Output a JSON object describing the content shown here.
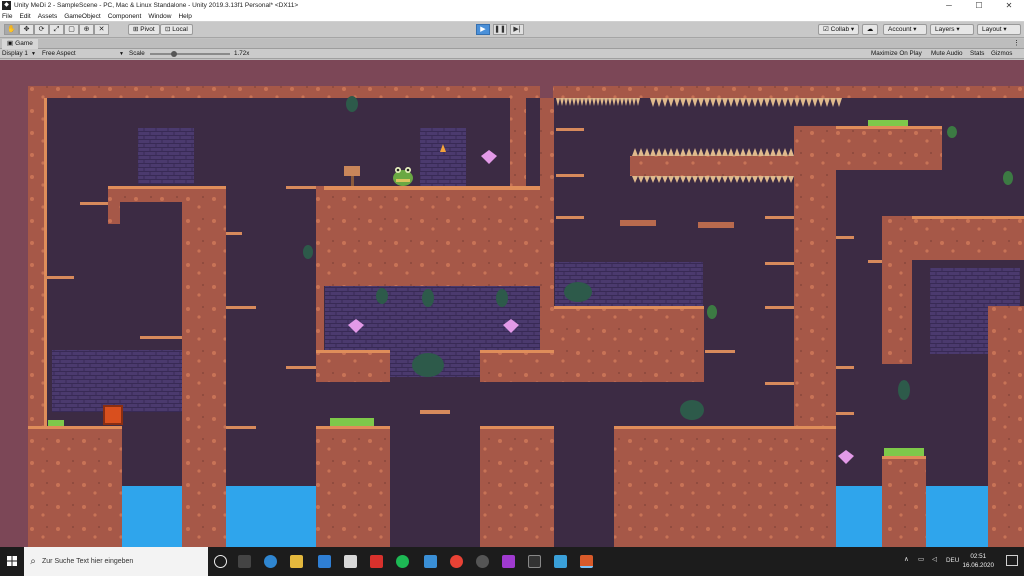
{
  "window": {
    "title": "Unity MeDi 2 - SampleScene - PC, Mac & Linux Standalone - Unity 2019.3.13f1 Personal* <DX11>",
    "app_icon": "unity-logo-icon",
    "controls": [
      "minimize-icon",
      "maximize-icon",
      "close-icon"
    ]
  },
  "menu": [
    "File",
    "Edit",
    "Assets",
    "GameObject",
    "Component",
    "Window",
    "Help"
  ],
  "toolbar": {
    "tools": [
      "hand-icon",
      "move-icon",
      "rotate-icon",
      "scale-icon",
      "rect-icon",
      "transform-icon",
      "custom-tool-icon"
    ],
    "pivot_label": "Pivot",
    "local_label": "Local",
    "collab_label": "Collab",
    "account_label": "Account",
    "layers_label": "Layers",
    "layout_label": "Layout"
  },
  "game_tab": {
    "label": "Game",
    "icon": "game-view-icon"
  },
  "game_controls": {
    "display": "Display 1",
    "aspect": "Free Aspect",
    "scale_label": "Scale",
    "scale_value": "1.72x",
    "scale_fraction": 0.3,
    "maximize": "Maximize On Play",
    "mute": "Mute Audio",
    "stats": "Stats",
    "gizmos": "Gizmos"
  },
  "taskbar": {
    "search_placeholder": "Zur Suche Text hier eingeben",
    "language": "DEU",
    "time": "02:51",
    "date": "16.06.2020"
  },
  "colors": {
    "play_active": "#4a90d9",
    "sky": "#3d2c44",
    "rock": "#aa5a4b",
    "rock_edge": "#df8d5a",
    "brick": "#4d3a70",
    "water": "#2fa5ec",
    "gem": "#e39ae8"
  }
}
